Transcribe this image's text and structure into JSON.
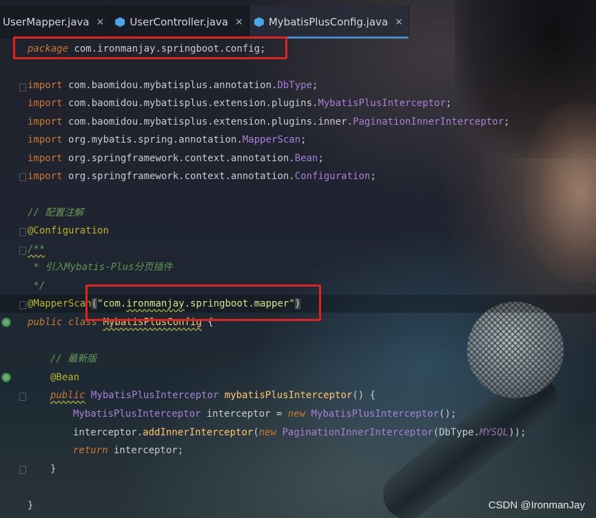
{
  "tabs": [
    {
      "label": "UserMapper.java",
      "close": "×",
      "icon": "java-interface-icon"
    },
    {
      "label": "UserController.java",
      "close": "×",
      "icon": "java-class-icon"
    },
    {
      "label": "MybatisPlusConfig.java",
      "close": "×",
      "icon": "java-class-icon",
      "active": true
    }
  ],
  "code": {
    "package_kw": "package",
    "package_name": " com.ironmanjay.springboot.config;",
    "import_kw": "import",
    "imports": [
      {
        "pkg": " com.baomidou.mybatisplus.annotation.",
        "cls": "DbType",
        "end": ";"
      },
      {
        "pkg": " com.baomidou.mybatisplus.extension.plugins.",
        "cls": "MybatisPlusInterceptor",
        "end": ";"
      },
      {
        "pkg": " com.baomidou.mybatisplus.extension.plugins.inner.",
        "cls": "PaginationInnerInterceptor",
        "end": ";"
      },
      {
        "pkg": " org.mybatis.spring.annotation.",
        "cls": "MapperScan",
        "end": ";"
      },
      {
        "pkg": " org.springframework.context.annotation.",
        "cls": "Bean",
        "end": ";"
      },
      {
        "pkg": " org.springframework.context.annotation.",
        "cls": "Configuration",
        "end": ";"
      }
    ],
    "comment_config": "// 配置注解",
    "ann_configuration": "@Configuration",
    "doc_open": "/**",
    "doc_line": " * 引入Mybatis-Plus分页插件",
    "doc_close": " */",
    "ann_mapperscan": "@MapperScan",
    "mapperscan_open": "(",
    "mapperscan_str_a": "\"com.",
    "mapperscan_str_b": "ironmanjay",
    "mapperscan_str_c": ".springboot.mapper\"",
    "mapperscan_close": ")",
    "public_kw": "public",
    "class_kw": "class",
    "class_name": "MybatisPlusConfig",
    "brace_open": " {",
    "comment_latest": "// 最新版",
    "ann_bean": "@Bean",
    "ret_type": "MybatisPlusInterceptor",
    "method_name": "mybatisPlusInterceptor",
    "method_sig_end": "() {",
    "l1_type": "MybatisPlusInterceptor",
    "l1_var": " interceptor = ",
    "new_kw": "new",
    "l1_ctor": "MybatisPlusInterceptor",
    "l1_end": "();",
    "l2_var": "interceptor.",
    "l2_method": "addInnerInterceptor",
    "l2_open": "(",
    "l2_ctor": "PaginationInnerInterceptor",
    "l2_dbtype": "(DbType.",
    "l2_field": "MYSQL",
    "l2_end": "));",
    "return_kw": "return",
    "return_val": " interceptor;",
    "close_method": "}",
    "close_class": "}"
  },
  "watermark": "CSDN @IronmanJay"
}
